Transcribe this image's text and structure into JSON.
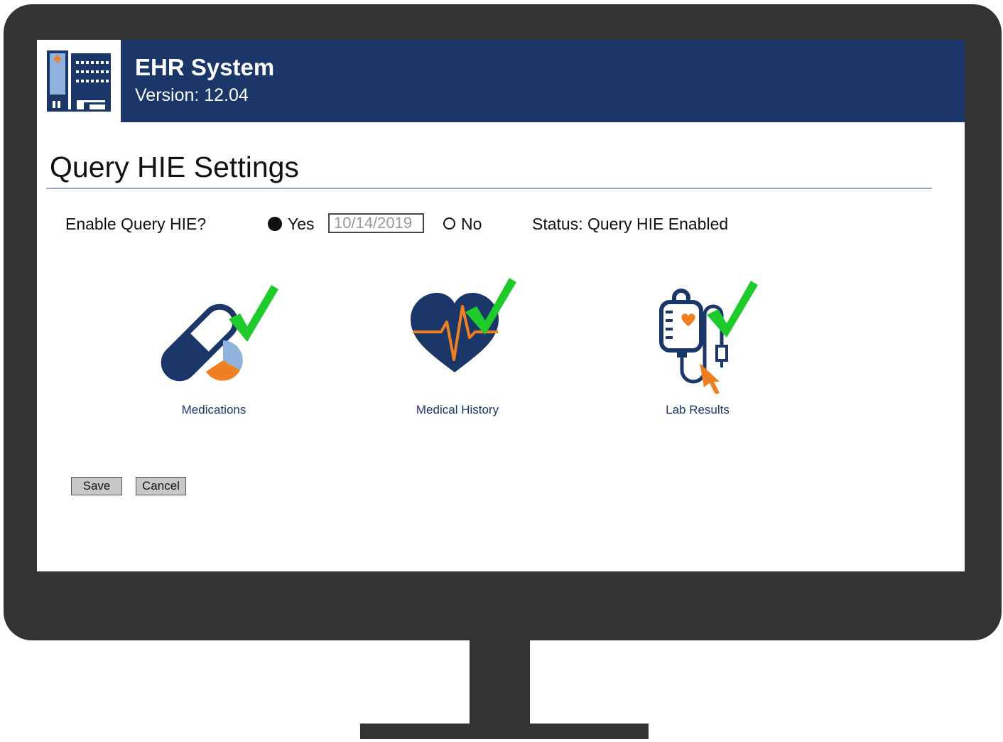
{
  "header": {
    "app_title": "EHR System",
    "version": "Version: 12.04",
    "logo_icon": "hospital-building-icon",
    "band_color": "#1b3668"
  },
  "page": {
    "title": "Query HIE Settings"
  },
  "settings": {
    "enable_label": "Enable Query HIE?",
    "yes_label": "Yes",
    "no_label": "No",
    "selected": "Yes",
    "date_value": "10/14/2019",
    "status": "Status: Query HIE Enabled"
  },
  "modules": [
    {
      "label": "Medications",
      "icon": "pill-icon",
      "checked": true
    },
    {
      "label": "Medical History",
      "icon": "heart-pulse-icon",
      "checked": true
    },
    {
      "label": "Lab Results",
      "icon": "iv-bag-icon",
      "checked": true
    }
  ],
  "buttons": {
    "save": "Save",
    "cancel": "Cancel"
  },
  "colors": {
    "brand_navy": "#1b3668",
    "accent_orange": "#f07f22",
    "accent_light_blue": "#8fb3dd",
    "check_green": "#1ecb2a"
  }
}
